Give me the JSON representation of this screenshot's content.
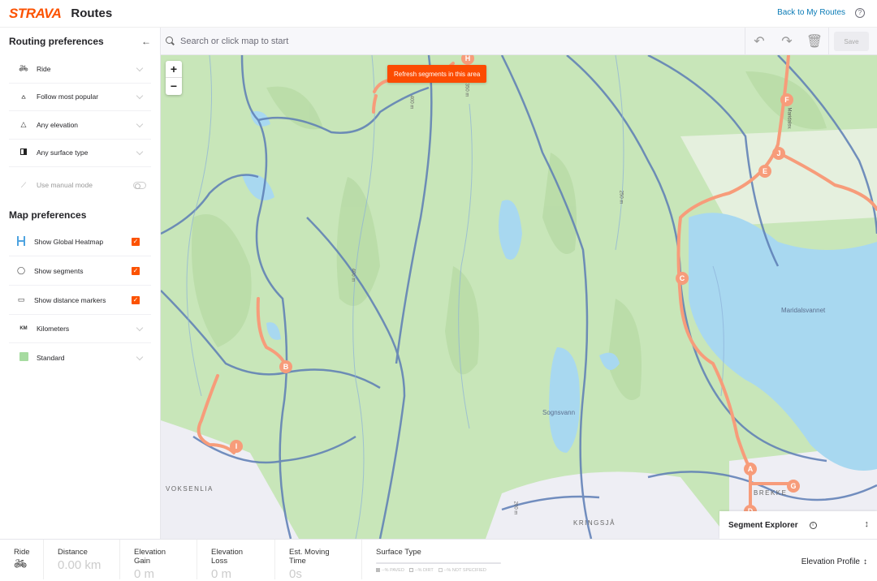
{
  "header": {
    "logo": "STRAVA",
    "title": "Routes",
    "back_link": "Back to My Routes",
    "help_icon": "?"
  },
  "sidebar": {
    "routing_title": "Routing preferences",
    "collapse_icon": "←",
    "routing_items": [
      {
        "icon": "bike-icon",
        "label": "Ride"
      },
      {
        "icon": "popularity-icon",
        "label": "Follow most popular"
      },
      {
        "icon": "elevation-icon",
        "label": "Any elevation"
      },
      {
        "icon": "surface-icon",
        "label": "Any surface type"
      }
    ],
    "manual_mode": {
      "label": "Use manual mode",
      "enabled": false
    },
    "map_title": "Map preferences",
    "map_toggles": [
      {
        "icon": "heatmap-icon",
        "label": "Show Global Heatmap",
        "checked": true
      },
      {
        "icon": "segment-pin-icon",
        "label": "Show segments",
        "checked": true
      },
      {
        "icon": "distance-marker-icon",
        "label": "Show distance markers",
        "checked": true
      }
    ],
    "map_selects": [
      {
        "icon": "KM",
        "label": "Kilometers"
      },
      {
        "icon": "map-style-icon",
        "label": "Standard"
      }
    ]
  },
  "search": {
    "placeholder": "Search or click map to start",
    "save_label": "Save"
  },
  "map": {
    "zoom_in": "+",
    "zoom_out": "−",
    "refresh_label": "Refresh segments in this area",
    "markers": [
      "H",
      "F",
      "J",
      "E",
      "C",
      "B",
      "I",
      "A",
      "G",
      "D"
    ],
    "lakes": [
      "Maridalsvannet",
      "Sognsvann"
    ],
    "places": [
      "VOKSENLIA",
      "KRINGSJÅ",
      "BREKKE"
    ],
    "contours": [
      "400 m",
      "350 m",
      "250 m",
      "400 m",
      "200 m"
    ],
    "road_label": "Maridalsv."
  },
  "segment_explorer": {
    "title": "Segment Explorer",
    "info_icon": "i"
  },
  "stats": {
    "ride_label": "Ride",
    "distance_label": "Distance",
    "distance_value": "0.00 km",
    "gain_label": "Elevation Gain",
    "gain_value": "0 m",
    "loss_label": "Elevation Loss",
    "loss_value": "0 m",
    "time_label": "Est. Moving Time",
    "time_value": "0s",
    "surface_label": "Surface Type",
    "surface_legend": [
      "--% PAVED",
      "--% DIRT",
      "--% NOT SPECIFIED"
    ],
    "elevation_profile_label": "Elevation Profile"
  },
  "colors": {
    "brand": "#fc5200",
    "link": "#0a7bb6",
    "route": "#f79c7a",
    "water": "#a8d8f0",
    "forest": "#c8e6b9"
  }
}
